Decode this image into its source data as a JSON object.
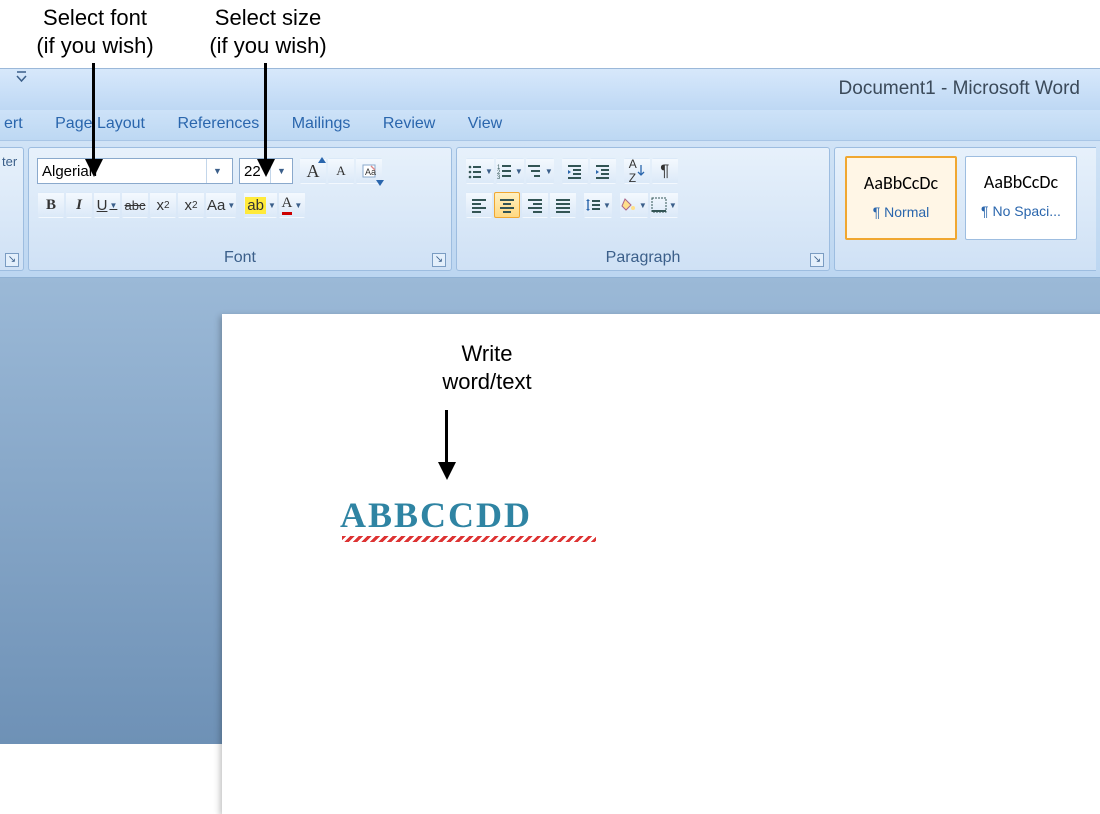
{
  "annotations": {
    "font": "Select font\n(if you wish)",
    "size": "Select size\n(if you wish)",
    "write": "Write\nword/text"
  },
  "window": {
    "title": "Document1 - Microsoft Word"
  },
  "tabs": {
    "ert": "ert",
    "page_layout": "Page Layout",
    "references": "References",
    "mailings": "Mailings",
    "review": "Review",
    "view": "View"
  },
  "font_group": {
    "label": "Font",
    "font_name": "Algerian",
    "font_size": "22",
    "bold": "B",
    "italic": "I",
    "underline": "U",
    "strike": "abc",
    "sub": "x",
    "sup": "x",
    "case": "Aa",
    "highlight_char": "ab",
    "color_char": "A",
    "grow": "A",
    "shrink": "A",
    "clear": "Aa"
  },
  "clipboard_group": {
    "label": "ter"
  },
  "para_group": {
    "label": "Paragraph"
  },
  "styles": {
    "sample": "AaBbCcDc",
    "normal": "¶ Normal",
    "nospacing": "¶ No Spaci..."
  },
  "document": {
    "text": "ABBCCDD"
  }
}
